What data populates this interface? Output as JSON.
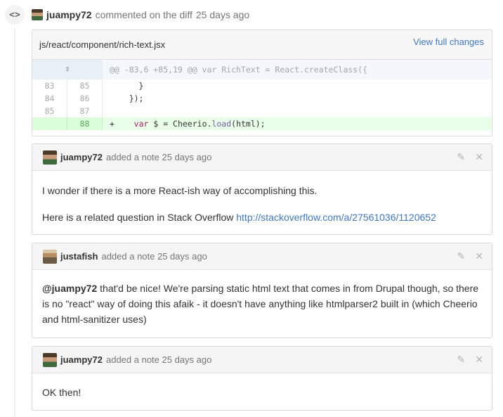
{
  "event": {
    "author": "juampy72",
    "action": "commented on the diff",
    "time": "25 days ago"
  },
  "file": {
    "path": "js/react/component/rich-text.jsx",
    "view_full_label": "View full changes"
  },
  "diff": {
    "hunk_header": "@@ -83,6 +85,19 @@ var RichText = React.createClass({",
    "lines": [
      {
        "old": "83",
        "new": "85",
        "code": "      }"
      },
      {
        "old": "84",
        "new": "86",
        "code": "    });"
      },
      {
        "old": "85",
        "new": "87",
        "code": ""
      }
    ],
    "added_line": {
      "new": "88",
      "prefix": "+",
      "indent": "    ",
      "kw": "var",
      "mid": " $ = Cheerio.",
      "fn": "load",
      "tail": "(html);"
    }
  },
  "notes": [
    {
      "author": "juampy72",
      "meta": "added a note 25 days ago",
      "paragraphs": [
        "I wonder if there is a more React-ish way of accomplishing this.",
        "Here is a related question in Stack Overflow "
      ],
      "link": "http://stackoverflow.com/a/27561036/1120652"
    },
    {
      "author": "justafish",
      "meta": "added a note 25 days ago",
      "mention": "@juampy72",
      "text": " that'd be nice! We're parsing static html text that comes in from Drupal though, so there is no \"react\" way of doing this afaik - it doesn't have anything like htmlparser2 built in (which Cheerio and html-sanitizer uses)"
    },
    {
      "author": "juampy72",
      "meta": "added a note 25 days ago",
      "text": "OK then!"
    }
  ],
  "icons": {
    "timeline": "code-icon",
    "edit": "pencil-icon",
    "close": "close-icon"
  },
  "colors": {
    "link": "#4078c0",
    "added_bg": "#eaffea",
    "hunk_bg": "#f4f7fb"
  }
}
